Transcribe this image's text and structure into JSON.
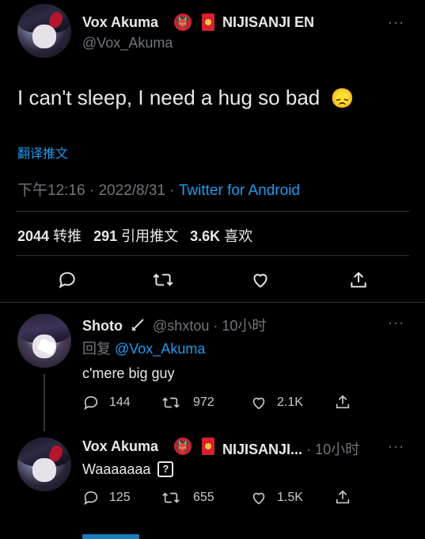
{
  "main_tweet": {
    "display_name": "Vox Akuma",
    "devil_emoji": "👹",
    "org_label": "NIJISANJI EN",
    "handle": "@Vox_Akuma",
    "text": "I can't sleep, I need a hug so bad",
    "text_emoji": "😞",
    "translate_label": "翻译推文",
    "time": "下午12:16",
    "date": "2022/8/31",
    "dot": "·",
    "source": "Twitter for Android",
    "retweets_count": "2044",
    "retweets_label": "转推",
    "quotes_count": "291",
    "quotes_label": "引用推文",
    "likes_count": "3.6K",
    "likes_label": "喜欢",
    "more_label": "···"
  },
  "replies": [
    {
      "display_name": "Shoto",
      "handle": "@shxtou",
      "dot": "·",
      "time_ago": "10小时",
      "reply_to_prefix": "回复",
      "reply_to_handle": "@Vox_Akuma",
      "text": "c'mere big guy",
      "reply_count": "144",
      "retweet_count": "972",
      "like_count": "2.1K",
      "more_label": "···"
    },
    {
      "display_name": "Vox Akuma",
      "devil_emoji": "👹",
      "org_label": "NIJISANJI...",
      "dot": "·",
      "time_ago": "10小时",
      "text": "Waaaaaaa",
      "unknown_glyph": "?",
      "reply_count": "125",
      "retweet_count": "655",
      "like_count": "1.5K",
      "more_label": "···"
    }
  ],
  "colors": {
    "background": "#000000",
    "text": "#e7e9ea",
    "muted": "#71767b",
    "link": "#1d9bf0",
    "divider": "#2f3336",
    "badge_red": "#d8202f"
  }
}
